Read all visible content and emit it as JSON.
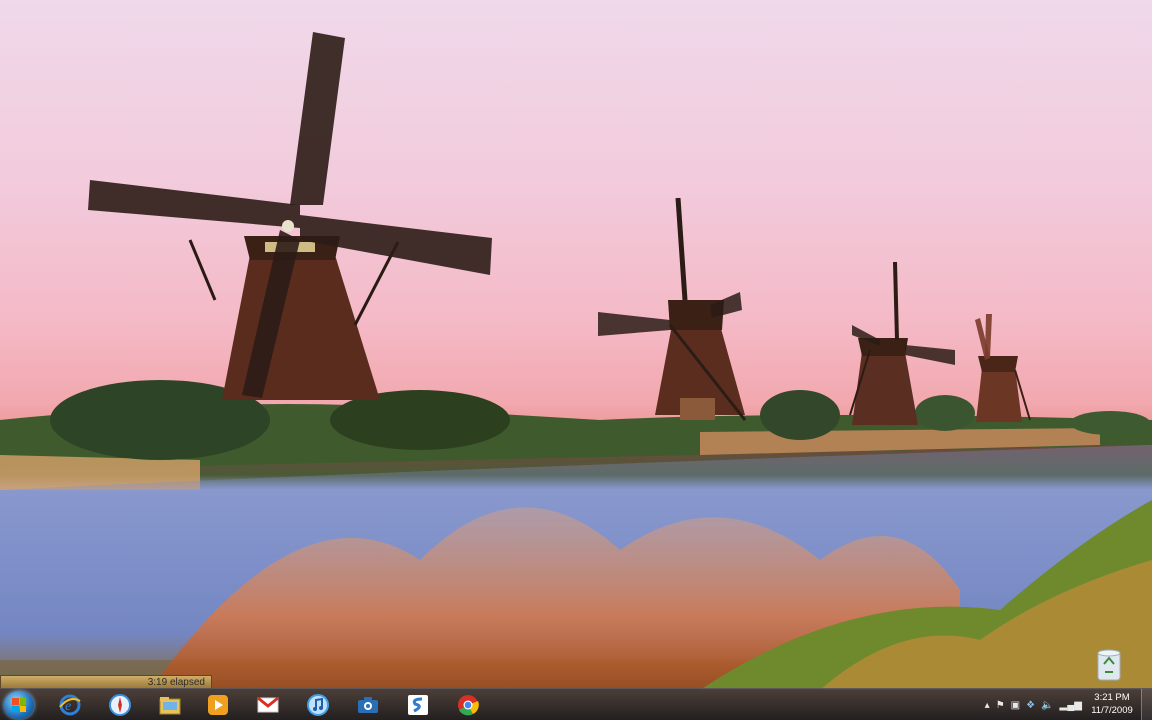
{
  "wallpaper": {
    "name": "windmills-wallpaper"
  },
  "desktop": {
    "recycle_bin_icon": "recycle-bin-icon"
  },
  "recorder": {
    "elapsed_text": "3:19 elapsed"
  },
  "taskbar": {
    "start_icon": "windows-start-icon",
    "pinned": [
      {
        "name": "internet-explorer-icon",
        "color": "#2f7fd8"
      },
      {
        "name": "safari-icon",
        "color": "#3a8fe0"
      },
      {
        "name": "windows-explorer-icon",
        "color": "#e8c25a"
      },
      {
        "name": "media-player-icon",
        "color": "#f0a020"
      },
      {
        "name": "gmail-icon",
        "color": "#d93025"
      },
      {
        "name": "itunes-icon",
        "color": "#3fa0e8"
      },
      {
        "name": "camera-icon",
        "color": "#2a6fb5"
      },
      {
        "name": "app-s-icon",
        "color": "#2e7dd1"
      },
      {
        "name": "chrome-icon",
        "color": "#34a853"
      }
    ],
    "tray_icons": [
      "show-hidden-icons",
      "action-center-flag-icon",
      "device-icon",
      "dropbox-icon",
      "volume-icon",
      "network-signal-icon"
    ],
    "clock": {
      "time": "3:21 PM",
      "date": "11/7/2009"
    }
  }
}
